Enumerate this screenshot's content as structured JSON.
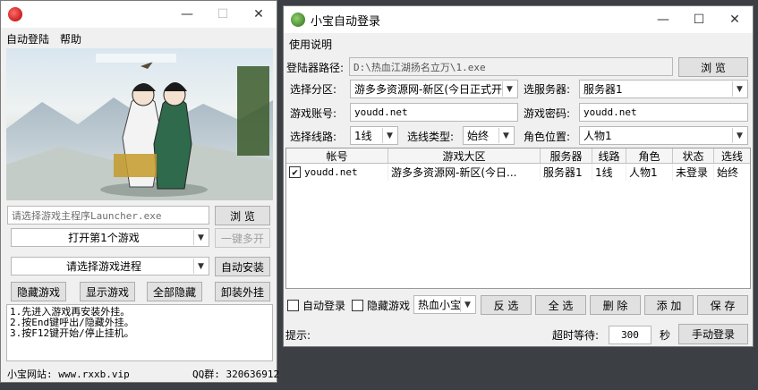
{
  "left": {
    "menu": [
      "自动登陆",
      "帮助"
    ],
    "exe_placeholder": "请选择游戏主程序Launcher.exe",
    "browse_label": "浏 览",
    "open_game": "打开第1个游戏",
    "multi_open_label": "一键多开",
    "select_process": "请选择游戏进程",
    "auto_install_label": "自动安装",
    "hide_game_label": "隐藏游戏",
    "show_game_label": "显示游戏",
    "hide_all_label": "全部隐藏",
    "uninstall_label": "卸装外挂",
    "log_lines": [
      "1.先进入游戏再安装外挂。",
      "2.按End键呼出/隐藏外挂。",
      "3.按F12键开始/停止挂机。"
    ],
    "site_label": "小宝网站: www.rxxb.vip",
    "qq_label": "QQ群: 320636912"
  },
  "right": {
    "title": "小宝自动登录",
    "menu": [
      "使用说明"
    ],
    "path_label": "登陆器路径:",
    "path_value": "D:\\热血江湖扬名立万\\1.exe",
    "browse_label": "浏 览",
    "region_label": "选择分区:",
    "region_value": "游多多资源网-新区(今日正式开",
    "server_label": "选服务器:",
    "server_value": "服务器1",
    "account_label": "游戏账号:",
    "account_value": "youdd.net",
    "password_label": "游戏密码:",
    "password_value": "youdd.net",
    "line_label": "选择线路:",
    "line_value": "1线",
    "line_type_label": "选线类型:",
    "line_type_value": "始终",
    "role_pos_label": "角色位置:",
    "role_pos_value": "人物1",
    "table": {
      "headers": [
        "帐号",
        "游戏大区",
        "服务器",
        "线路",
        "角色",
        "状态",
        "选线"
      ],
      "rows": [
        {
          "account": "youdd.net",
          "region": "游多多资源网-新区(今日...",
          "server": "服务器1",
          "line": "1线",
          "role": "人物1",
          "status": "未登录",
          "select": "始终"
        }
      ]
    },
    "auto_login_label": "自动登录",
    "hide_game_label": "隐藏游戏",
    "hotkey_value": "热血小宝",
    "invert_label": "反 选",
    "select_all_label": "全 选",
    "delete_label": "删 除",
    "add_label": "添 加",
    "save_label": "保 存",
    "hint_label": "提示:",
    "timeout_label": "超时等待:",
    "timeout_value": "300",
    "seconds_label": "秒",
    "manual_login_label": "手动登录"
  }
}
